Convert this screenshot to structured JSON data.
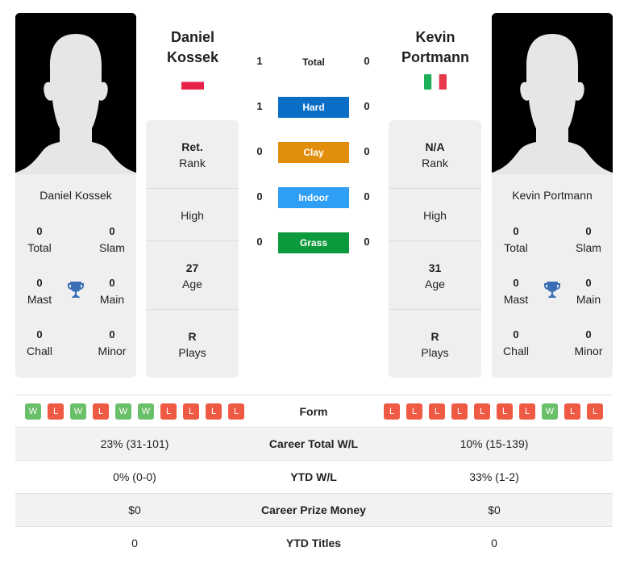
{
  "player1": {
    "name": "Daniel Kossek",
    "name_line1": "Daniel",
    "name_line2": "Kossek",
    "flag": "poland-flag",
    "titles": {
      "total": "0",
      "slam": "0",
      "mast": "0",
      "main": "0",
      "chall": "0",
      "minor": "0"
    },
    "rank_value": "Ret.",
    "high_value": "",
    "age_value": "27",
    "plays_value": "R",
    "form": [
      "W",
      "L",
      "W",
      "L",
      "W",
      "W",
      "L",
      "L",
      "L",
      "L"
    ]
  },
  "player2": {
    "name": "Kevin Portmann",
    "name_line1": "Kevin",
    "name_line2": "Portmann",
    "flag": "italy-flag",
    "titles": {
      "total": "0",
      "slam": "0",
      "mast": "0",
      "main": "0",
      "chall": "0",
      "minor": "0"
    },
    "rank_value": "N/A",
    "high_value": "",
    "age_value": "31",
    "plays_value": "R",
    "form": [
      "L",
      "L",
      "L",
      "L",
      "L",
      "L",
      "L",
      "W",
      "L",
      "L"
    ]
  },
  "labels": {
    "total": "Total",
    "slam": "Slam",
    "mast": "Mast",
    "main": "Main",
    "chall": "Chall",
    "minor": "Minor",
    "rank": "Rank",
    "high": "High",
    "age": "Age",
    "plays": "Plays",
    "form": "Form"
  },
  "h2h": [
    {
      "label": "Total",
      "p1": "1",
      "p2": "0",
      "color": ""
    },
    {
      "label": "Hard",
      "p1": "1",
      "p2": "0",
      "color": "#0a6ec6"
    },
    {
      "label": "Clay",
      "p1": "0",
      "p2": "0",
      "color": "#e08e0b"
    },
    {
      "label": "Indoor",
      "p1": "0",
      "p2": "0",
      "color": "#2e9ff5"
    },
    {
      "label": "Grass",
      "p1": "0",
      "p2": "0",
      "color": "#0c9a3c"
    }
  ],
  "comparison": [
    {
      "label": "Career Total W/L",
      "p1": "23% (31-101)",
      "p2": "10% (15-139)"
    },
    {
      "label": "YTD W/L",
      "p1": "0% (0-0)",
      "p2": "33% (1-2)"
    },
    {
      "label": "Career Prize Money",
      "p1": "$0",
      "p2": "$0"
    },
    {
      "label": "YTD Titles",
      "p1": "0",
      "p2": "0"
    }
  ],
  "colors": {
    "win": "#6abf69",
    "loss": "#ee5a43",
    "trophy": "#3a6fb5",
    "card_bg": "#efefef"
  }
}
